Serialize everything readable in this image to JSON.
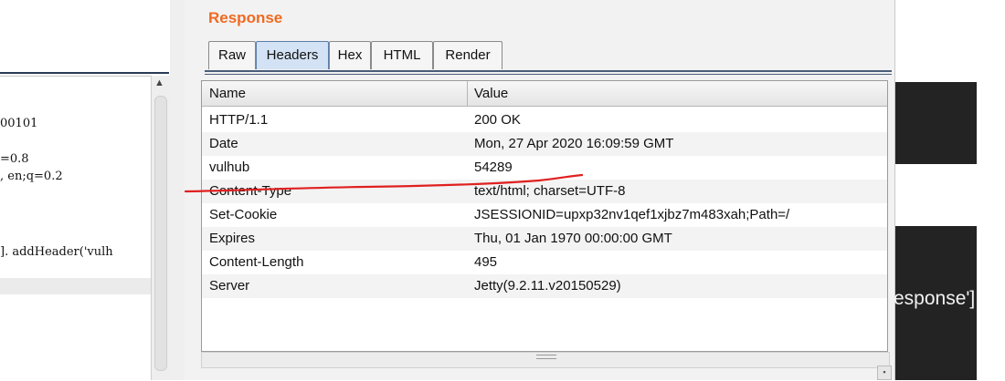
{
  "request_pane": {
    "code_lines": [
      "00101",
      "=0.8",
      ", en;q=0.2",
      "]. addHeader('vulh"
    ]
  },
  "response": {
    "title": "Response",
    "tabs": [
      {
        "label": "Raw",
        "active": false
      },
      {
        "label": "Headers",
        "active": true
      },
      {
        "label": "Hex",
        "active": false
      },
      {
        "label": "HTML",
        "active": false
      },
      {
        "label": "Render",
        "active": false
      }
    ],
    "table": {
      "columns": [
        "Name",
        "Value"
      ],
      "rows": [
        {
          "name": "HTTP/1.1",
          "value": "200 OK"
        },
        {
          "name": "Date",
          "value": "Mon, 27 Apr 2020 16:09:59 GMT"
        },
        {
          "name": "vulhub",
          "value": "54289"
        },
        {
          "name": "Content-Type",
          "value": "text/html; charset=UTF-8"
        },
        {
          "name": "Set-Cookie",
          "value": "JSESSIONID=upxp32nv1qef1xjbz7m483xah;Path=/"
        },
        {
          "name": "Expires",
          "value": "Thu, 01 Jan 1970 00:00:00 GMT"
        },
        {
          "name": "Content-Length",
          "value": "495"
        },
        {
          "name": "Server",
          "value": "Jetty(9.2.11.v20150529)"
        }
      ]
    }
  },
  "background_fragment": {
    "text": "esponse']"
  },
  "colors": {
    "title_orange": "#f06a21",
    "active_tab": "#d3e2f4",
    "annotation_red": "#e02020",
    "dark_bg": "#232323"
  }
}
